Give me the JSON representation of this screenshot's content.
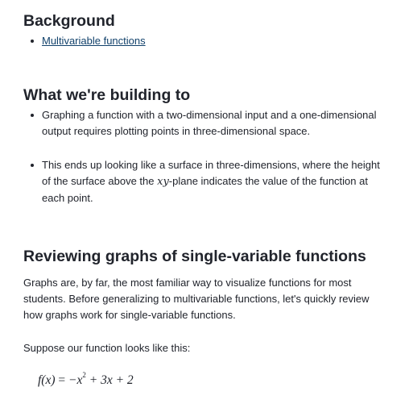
{
  "background": {
    "heading": "Background",
    "links": [
      "Multivariable functions"
    ]
  },
  "building": {
    "heading": "What we're building to",
    "bullet1": "Graphing a function with a two-dimensional input and a one-dimensional output requires plotting points in three-dimensional space.",
    "bullet2_before": "This ends up looking like a surface in three-dimensions, where the height of the surface above the ",
    "bullet2_math": "xy",
    "bullet2_after": "-plane indicates the value of the function at each point."
  },
  "reviewing": {
    "heading": "Reviewing graphs of single-variable functions",
    "paragraph": "Graphs are, by far, the most familiar way to visualize functions for most students. Before generalizing to multivariable functions, let's quickly review how graphs work for single-variable functions.",
    "suppose": "Suppose our function looks like this:",
    "formula": {
      "lhs": "f(x)",
      "equals": "=",
      "term1": "−x",
      "exponent": "2",
      "rest": "+ 3x + 2"
    }
  }
}
